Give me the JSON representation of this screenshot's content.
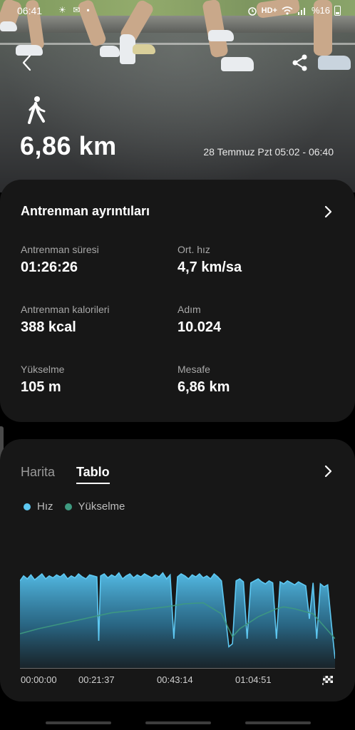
{
  "status_bar": {
    "time": "06:41",
    "icons_left": "☀ ✉ ▪",
    "network": "HD+",
    "battery": "%16"
  },
  "hero": {
    "distance": "6,86 km",
    "date_range": "28 Temmuz Pzt 05:02 - 06:40",
    "activity_icon": "walking-icon"
  },
  "details": {
    "title": "Antrenman ayrıntıları",
    "stats": [
      {
        "label": "Antrenman süresi",
        "value": "01:26:26"
      },
      {
        "label": "Ort. hız",
        "value": "4,7 km/sa"
      },
      {
        "label": "Antrenman kalorileri",
        "value": "388 kcal"
      },
      {
        "label": "Adım",
        "value": "10.024"
      },
      {
        "label": "Yükselme",
        "value": "105 m"
      },
      {
        "label": "Mesafe",
        "value": "6,86 km"
      }
    ]
  },
  "chart_card": {
    "tabs": [
      "Harita",
      "Tablo"
    ],
    "active_tab": "Tablo",
    "legend": [
      {
        "name": "Hız",
        "color": "#5ec8f2"
      },
      {
        "name": "Yükselme",
        "color": "#3e9a80"
      }
    ],
    "x_labels": [
      "00:00:00",
      "00:21:37",
      "00:43:14",
      "01:04:51"
    ]
  },
  "chart_data": {
    "type": "area",
    "x_ticks": [
      "00:00:00",
      "00:21:37",
      "00:43:14",
      "01:04:51"
    ],
    "x_range_minutes": [
      0,
      86.4
    ],
    "series": [
      {
        "name": "Hız",
        "color": "#5ec8f2",
        "x": [
          0,
          1,
          2,
          3,
          4,
          5,
          6,
          7,
          8,
          9,
          10,
          11,
          12,
          13,
          14,
          15,
          16,
          17,
          18,
          19,
          20,
          21,
          21.5,
          22,
          23,
          24,
          25,
          26,
          27,
          28,
          29,
          30,
          31,
          32,
          33,
          34,
          35,
          36,
          37,
          38,
          39,
          40,
          41,
          42,
          43,
          44,
          45,
          46,
          47,
          48,
          49,
          50,
          51,
          52,
          53,
          54,
          55,
          56,
          57,
          58,
          59,
          60,
          61,
          62,
          63,
          64,
          65,
          66,
          67,
          68,
          69,
          70,
          71,
          72,
          73,
          74,
          75,
          76,
          77,
          78,
          79,
          80,
          81,
          82,
          83,
          84,
          85,
          86
        ],
        "values": [
          0.88,
          0.93,
          0.9,
          0.94,
          0.89,
          0.92,
          0.95,
          0.9,
          0.93,
          0.91,
          0.94,
          0.92,
          0.95,
          0.9,
          0.93,
          0.91,
          0.95,
          0.92,
          0.9,
          0.94,
          0.93,
          0.92,
          0.28,
          0.93,
          0.95,
          0.91,
          0.94,
          0.92,
          0.96,
          0.9,
          0.93,
          0.95,
          0.91,
          0.94,
          0.92,
          0.95,
          0.93,
          0.91,
          0.94,
          0.92,
          0.96,
          0.9,
          0.94,
          0.3,
          0.92,
          0.95,
          0.93,
          0.9,
          0.94,
          0.92,
          0.95,
          0.91,
          0.93,
          0.9,
          0.95,
          0.92,
          0.88,
          0.55,
          0.22,
          0.25,
          0.88,
          0.9,
          0.87,
          0.3,
          0.86,
          0.88,
          0.9,
          0.87,
          0.85,
          0.88,
          0.86,
          0.3,
          0.87,
          0.85,
          0.88,
          0.86,
          0.84,
          0.87,
          0.85,
          0.83,
          0.5,
          0.86,
          0.3,
          0.85,
          0.82,
          0.84,
          0.45,
          0.1
        ],
        "unit": "km/sa (relative)"
      },
      {
        "name": "Yükselme",
        "color": "#3e9a80",
        "x": [
          0,
          5,
          10,
          15,
          20,
          25,
          30,
          35,
          40,
          45,
          50,
          55,
          58,
          60,
          65,
          70,
          72,
          75,
          80,
          86
        ],
        "values": [
          0.35,
          0.4,
          0.44,
          0.48,
          0.52,
          0.56,
          0.58,
          0.6,
          0.62,
          0.65,
          0.66,
          0.55,
          0.32,
          0.4,
          0.52,
          0.6,
          0.62,
          0.6,
          0.55,
          0.3
        ]
      }
    ]
  }
}
